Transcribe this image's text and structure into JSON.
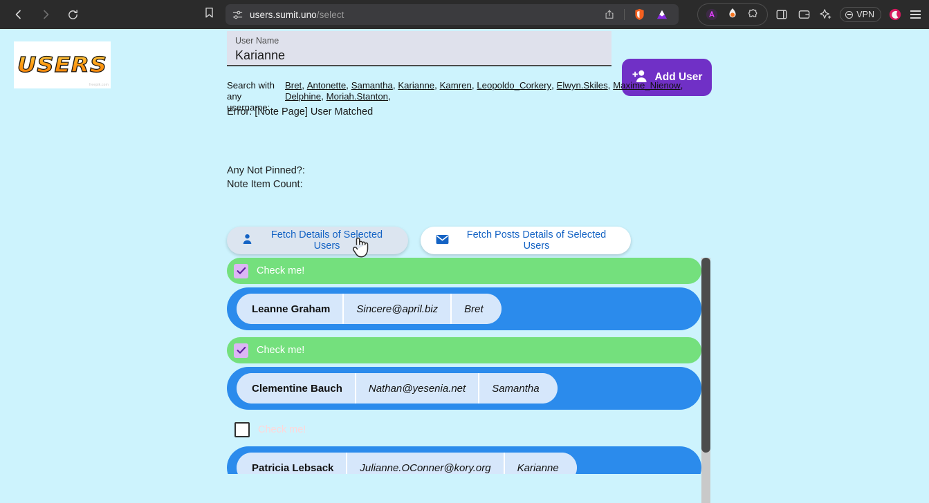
{
  "browser": {
    "back_icon": "back-arrow-icon",
    "forward_icon": "forward-arrow-icon",
    "reload_icon": "reload-icon",
    "bookmark_icon": "bookmark-icon",
    "url_shield_icon": "site-settings-icon",
    "url_domain": "users.sumit.uno",
    "url_path": "/select",
    "share_icon": "share-icon",
    "brave_icon": "brave-shields-icon",
    "triangle_icon": "triangle-extension-icon",
    "vpn_label": "VPN",
    "menu_icon": "hamburger-menu-icon"
  },
  "logo": {
    "text": "USERS",
    "credit": "freepik.com"
  },
  "form": {
    "username_label": "User Name",
    "username_value": "Karianne",
    "username_placeholder": "User Name",
    "add_user_label": "Add User",
    "add_user_icon": "person-add-icon",
    "add_user_color": "#7030c6"
  },
  "search": {
    "lead_line1": "Search with",
    "lead_line2": "any username:",
    "usernames": [
      "Bret",
      "Antonette",
      "Samantha",
      "Karianne",
      "Kamren",
      "Leopoldo_Corkery",
      "Elwyn.Skiles",
      "Maxime_Nienow",
      "Delphine",
      "Moriah.Stanton"
    ]
  },
  "status": {
    "error": "Error: [Note Page] User Matched",
    "any_not_pinned": "Any Not Pinned?:",
    "note_item_count": "Note Item Count:"
  },
  "actions": {
    "fetch_details_label": "Fetch Details of Selected Users",
    "fetch_details_icon": "person-icon",
    "fetch_posts_label": "Fetch Posts Details of Selected Users",
    "fetch_posts_icon": "envelope-icon"
  },
  "list": {
    "check_label": "Check me!",
    "rows": [
      {
        "checked": true,
        "name": "Leanne Graham",
        "email": "Sincere@april.biz",
        "username": "Bret"
      },
      {
        "checked": true,
        "name": "Clementine Bauch",
        "email": "Nathan@yesenia.net",
        "username": "Samantha"
      },
      {
        "checked": false,
        "name": "Patricia Lebsack",
        "email": "Julianne.OConner@kory.org",
        "username": "Karianne"
      }
    ]
  },
  "colors": {
    "page_background": "#cdf3fd",
    "row_blue": "#2b8bec",
    "check_green": "#74e07d",
    "cell_blue": "#d6e7fb",
    "link_blue": "#1463c4"
  }
}
